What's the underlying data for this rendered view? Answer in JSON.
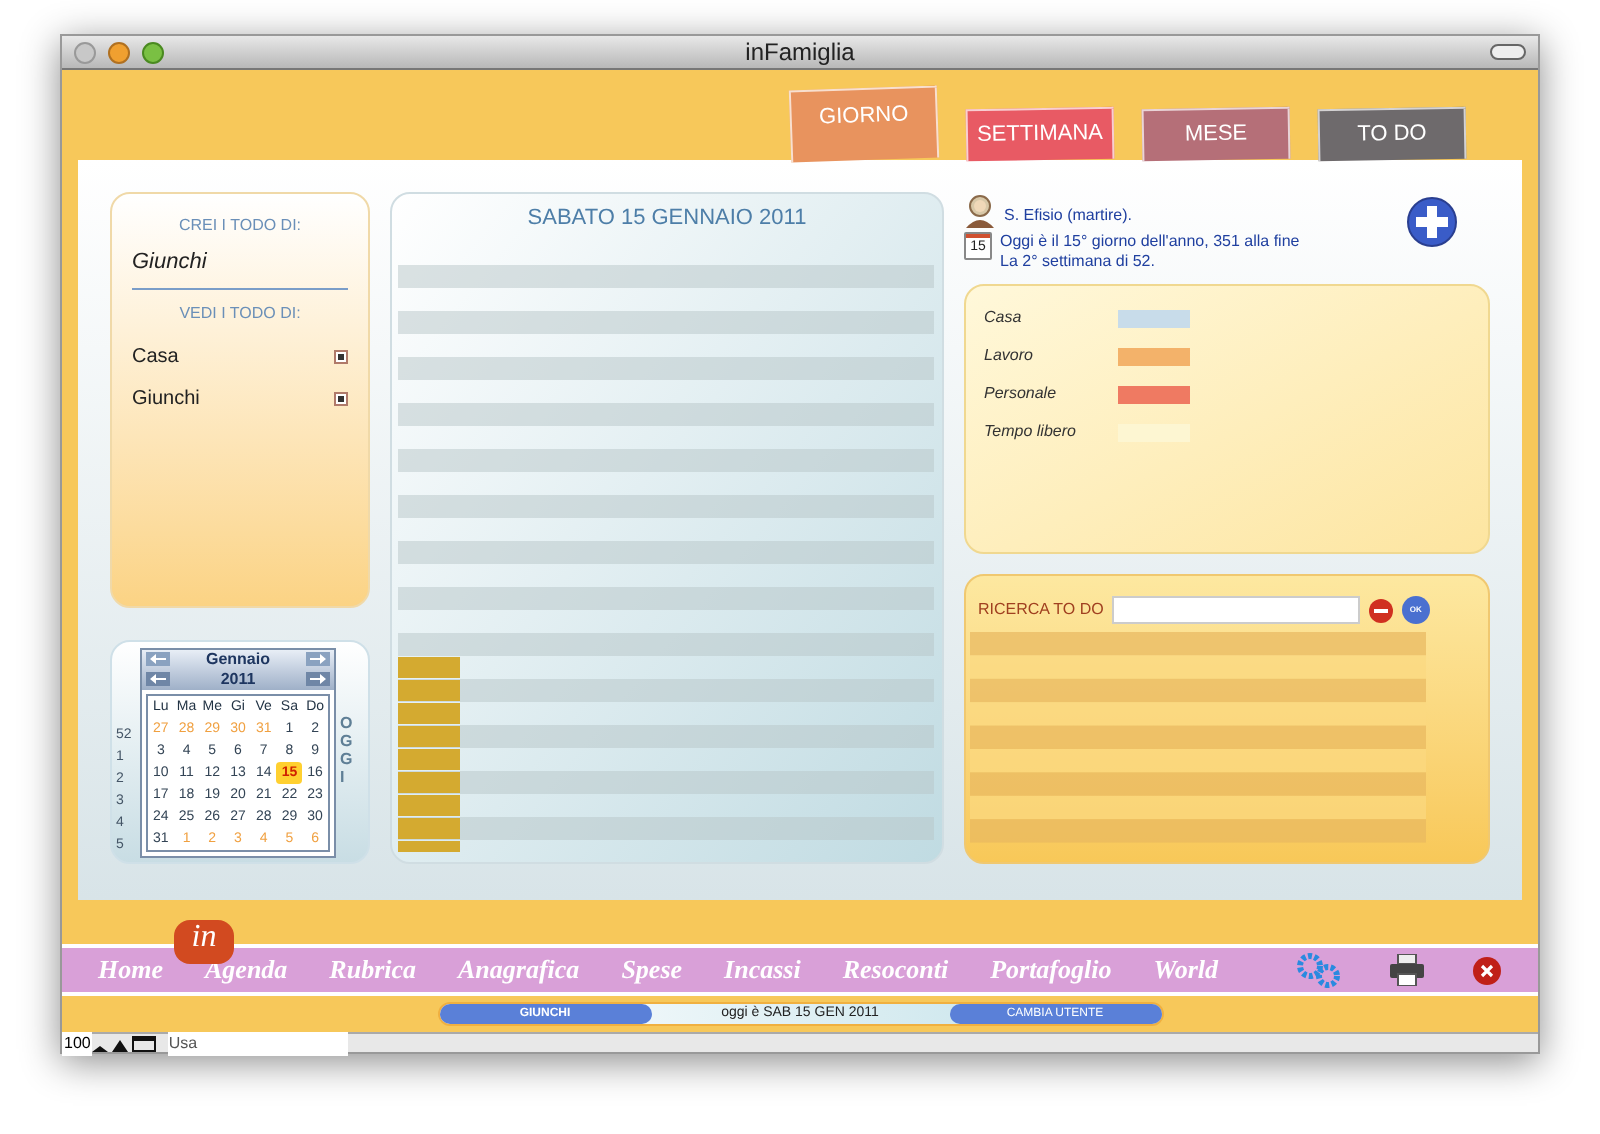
{
  "window": {
    "title": "inFamiglia"
  },
  "tabs": [
    {
      "label": "GIORNO",
      "selected": true
    },
    {
      "label": "SETTIMANA",
      "selected": false
    },
    {
      "label": "MESE",
      "selected": false
    },
    {
      "label": "TO DO",
      "selected": false
    }
  ],
  "todo_panel": {
    "create_heading": "CREI I TODO DI:",
    "create_user": "Giunchi",
    "view_heading": "VEDI I TODO DI:",
    "view_items": [
      {
        "label": "Casa",
        "checked": true
      },
      {
        "label": "Giunchi",
        "checked": true
      }
    ]
  },
  "calendar": {
    "month": "Gennaio",
    "year": "2011",
    "today_label": "OGGI",
    "weekdays": [
      "Lu",
      "Ma",
      "Me",
      "Gi",
      "Ve",
      "Sa",
      "Do"
    ],
    "weeks": [
      {
        "number": "52",
        "days": [
          {
            "day": "27",
            "other_month": true,
            "selected": false
          },
          {
            "day": "28",
            "other_month": true,
            "selected": false
          },
          {
            "day": "29",
            "other_month": true,
            "selected": false
          },
          {
            "day": "30",
            "other_month": true,
            "selected": false
          },
          {
            "day": "31",
            "other_month": true,
            "selected": false
          },
          {
            "day": "1",
            "other_month": false,
            "selected": false
          },
          {
            "day": "2",
            "other_month": false,
            "selected": false
          }
        ]
      },
      {
        "number": "1",
        "days": [
          {
            "day": "3",
            "other_month": false,
            "selected": false
          },
          {
            "day": "4",
            "other_month": false,
            "selected": false
          },
          {
            "day": "5",
            "other_month": false,
            "selected": false
          },
          {
            "day": "6",
            "other_month": false,
            "selected": false
          },
          {
            "day": "7",
            "other_month": false,
            "selected": false
          },
          {
            "day": "8",
            "other_month": false,
            "selected": false
          },
          {
            "day": "9",
            "other_month": false,
            "selected": false
          }
        ]
      },
      {
        "number": "2",
        "days": [
          {
            "day": "10",
            "other_month": false,
            "selected": false
          },
          {
            "day": "11",
            "other_month": false,
            "selected": false
          },
          {
            "day": "12",
            "other_month": false,
            "selected": false
          },
          {
            "day": "13",
            "other_month": false,
            "selected": false
          },
          {
            "day": "14",
            "other_month": false,
            "selected": false
          },
          {
            "day": "15",
            "other_month": false,
            "selected": true
          },
          {
            "day": "16",
            "other_month": false,
            "selected": false
          }
        ]
      },
      {
        "number": "3",
        "days": [
          {
            "day": "17",
            "other_month": false,
            "selected": false
          },
          {
            "day": "18",
            "other_month": false,
            "selected": false
          },
          {
            "day": "19",
            "other_month": false,
            "selected": false
          },
          {
            "day": "20",
            "other_month": false,
            "selected": false
          },
          {
            "day": "21",
            "other_month": false,
            "selected": false
          },
          {
            "day": "22",
            "other_month": false,
            "selected": false
          },
          {
            "day": "23",
            "other_month": false,
            "selected": false
          }
        ]
      },
      {
        "number": "4",
        "days": [
          {
            "day": "24",
            "other_month": false,
            "selected": false
          },
          {
            "day": "25",
            "other_month": false,
            "selected": false
          },
          {
            "day": "26",
            "other_month": false,
            "selected": false
          },
          {
            "day": "27",
            "other_month": false,
            "selected": false
          },
          {
            "day": "28",
            "other_month": false,
            "selected": false
          },
          {
            "day": "29",
            "other_month": false,
            "selected": false
          },
          {
            "day": "30",
            "other_month": false,
            "selected": false
          }
        ]
      },
      {
        "number": "5",
        "days": [
          {
            "day": "31",
            "other_month": false,
            "selected": false
          },
          {
            "day": "1",
            "other_month": true,
            "selected": false
          },
          {
            "day": "2",
            "other_month": true,
            "selected": false
          },
          {
            "day": "3",
            "other_month": true,
            "selected": false
          },
          {
            "day": "4",
            "other_month": true,
            "selected": false
          },
          {
            "day": "5",
            "other_month": true,
            "selected": false
          },
          {
            "day": "6",
            "other_month": true,
            "selected": false
          }
        ]
      }
    ]
  },
  "day_view": {
    "title": "SABATO 15 GENNAIO 2011"
  },
  "info": {
    "saint": "S. Efisio (martire).",
    "day_line": "Oggi è il 15° giorno dell'anno, 351 alla fine",
    "week_line": "La 2° settimana di 52.",
    "calendar_icon_day": "15"
  },
  "legend": [
    {
      "label": "Casa",
      "color": "#c8dcea"
    },
    {
      "label": "Lavoro",
      "color": "#f3b26a"
    },
    {
      "label": "Personale",
      "color": "#ef7a62"
    },
    {
      "label": "Tempo libero",
      "color": "#fdf6d2"
    }
  ],
  "search": {
    "label": "RICERCA TO DO",
    "ok_label": "OK"
  },
  "nav": {
    "badge": "in",
    "items": [
      "Home",
      "Agenda",
      "Rubrica",
      "Anagrafica",
      "Spese",
      "Incassi",
      "Resoconti",
      "Portafoglio",
      "World"
    ]
  },
  "user_bar": {
    "user": "GIUNCHI",
    "today_prefix": "oggi è",
    "date": "SAB 15 GEN 2011",
    "switch_user": "CAMBIA UTENTE"
  },
  "status_bar": {
    "zoom": "100",
    "mode": "Usa"
  }
}
